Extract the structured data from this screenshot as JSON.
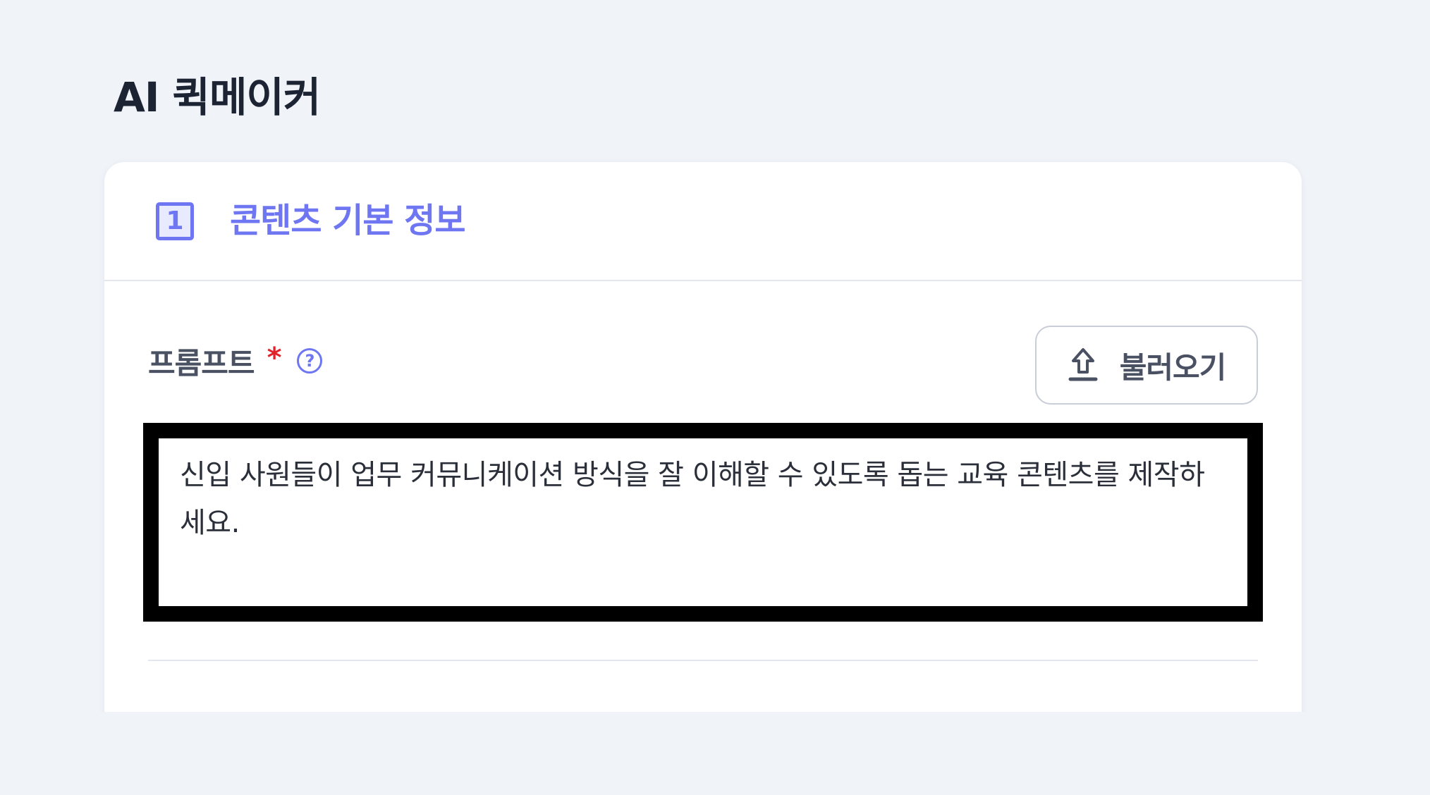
{
  "page": {
    "title": "AI 퀵메이커"
  },
  "section": {
    "step_number": "1",
    "title": "콘텐츠 기본 정보"
  },
  "prompt_field": {
    "label": "프롬프트",
    "required_mark": "*",
    "help_icon": "help-circle-icon",
    "value": "신입 사원들이 업무 커뮤니케이션 방식을 잘 이해할 수 있도록 돕는 교육 콘텐츠를 제작하세요."
  },
  "load_button": {
    "label": "불러오기",
    "icon": "upload-icon"
  },
  "colors": {
    "accent": "#6e76f2",
    "required": "#e0242c",
    "background": "#f0f3f8",
    "text_dark": "#1c2333"
  }
}
